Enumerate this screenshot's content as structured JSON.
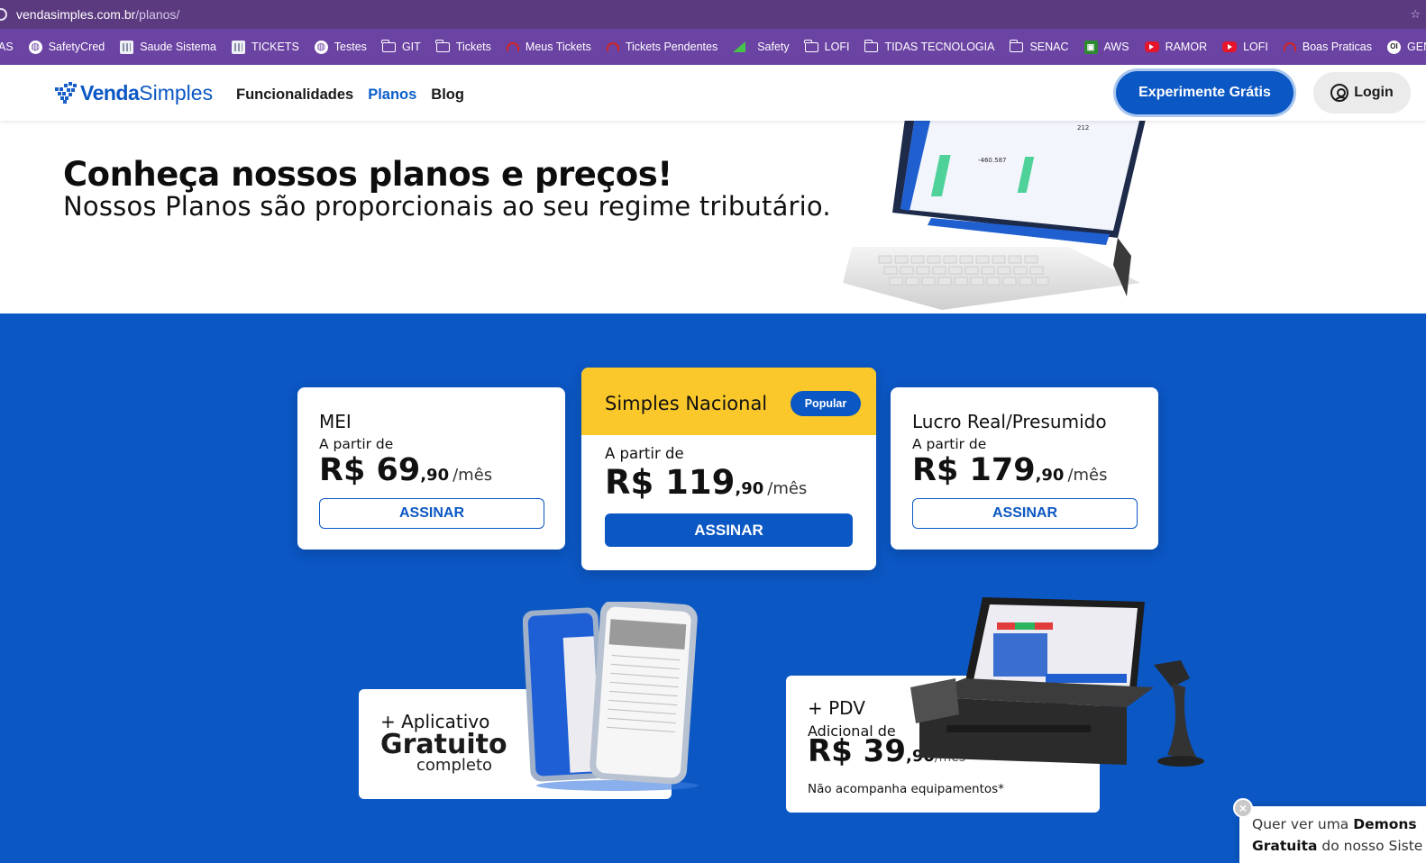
{
  "browser": {
    "url_host": "vendasimples.com.br",
    "url_path": "/planos/",
    "bookmarks": [
      {
        "label": "AS",
        "icon": "none"
      },
      {
        "label": "SafetyCred",
        "icon": "globe-icon"
      },
      {
        "label": "Saude Sistema",
        "icon": "grid-icon"
      },
      {
        "label": "TICKETS",
        "icon": "grid-icon"
      },
      {
        "label": "Testes",
        "icon": "globe-icon"
      },
      {
        "label": "GIT",
        "icon": "folder-icon"
      },
      {
        "label": "Tickets",
        "icon": "folder-icon"
      },
      {
        "label": "Meus Tickets",
        "icon": "headset-icon"
      },
      {
        "label": "Tickets Pendentes",
        "icon": "headset-icon"
      },
      {
        "label": "Safety",
        "icon": "triangle-icon"
      },
      {
        "label": "LOFI",
        "icon": "folder-icon"
      },
      {
        "label": "TIDAS TECNOLOGIA",
        "icon": "folder-icon"
      },
      {
        "label": "SENAC",
        "icon": "folder-icon"
      },
      {
        "label": "AWS",
        "icon": "aws-icon"
      },
      {
        "label": "RAMOR",
        "icon": "youtube-icon"
      },
      {
        "label": "LOFI",
        "icon": "youtube-icon"
      },
      {
        "label": "Boas Praticas",
        "icon": "headset-icon"
      },
      {
        "label": "GEN AI",
        "icon": "gen-icon"
      }
    ]
  },
  "header": {
    "logo_part1": "Venda",
    "logo_part2": "Simples",
    "nav": [
      {
        "label": "Funcionalidades",
        "active": false
      },
      {
        "label": "Planos",
        "active": true
      },
      {
        "label": "Blog",
        "active": false
      }
    ],
    "cta_label": "Experimente Grátis",
    "login_label": "Login"
  },
  "hero": {
    "title": "Conheça nossos planos e preços!",
    "subtitle": "Nossos Planos são proporcionais ao seu regime tributário."
  },
  "plans": [
    {
      "name": "MEI",
      "from": "A partir de",
      "currency_int": "R$ 69",
      "cents": ",90",
      "period": "/mês",
      "button": "ASSINAR"
    },
    {
      "name": "Simples Nacional",
      "badge": "Popular",
      "from": "A partir de",
      "currency_int": "R$ 119",
      "cents": ",90",
      "period": "/mês",
      "button": "ASSINAR"
    },
    {
      "name": "Lucro Real/Presumido",
      "from": "A partir de",
      "currency_int": "R$ 179",
      "cents": ",90",
      "period": "/mês",
      "button": "ASSINAR"
    }
  ],
  "addons": {
    "app_line1": "+ Aplicativo",
    "app_line2": "Gratuito",
    "app_line3": "completo",
    "pdv_title": "+ PDV",
    "pdv_from": "Adicional de",
    "pdv_int": "R$ 39",
    "pdv_cents": ",90",
    "pdv_period": "/mês",
    "pdv_note": "Não acompanha equipamentos*"
  },
  "chat": {
    "line1_prefix": "Quer ver uma ",
    "line1_bold": "Demons",
    "line2_bold": "Gratuita",
    "line2_rest": " do nosso Siste"
  },
  "colors": {
    "brand_blue": "#0b57c4",
    "featured_yellow": "#fbc82b",
    "browser_purple": "#6b43a3"
  }
}
